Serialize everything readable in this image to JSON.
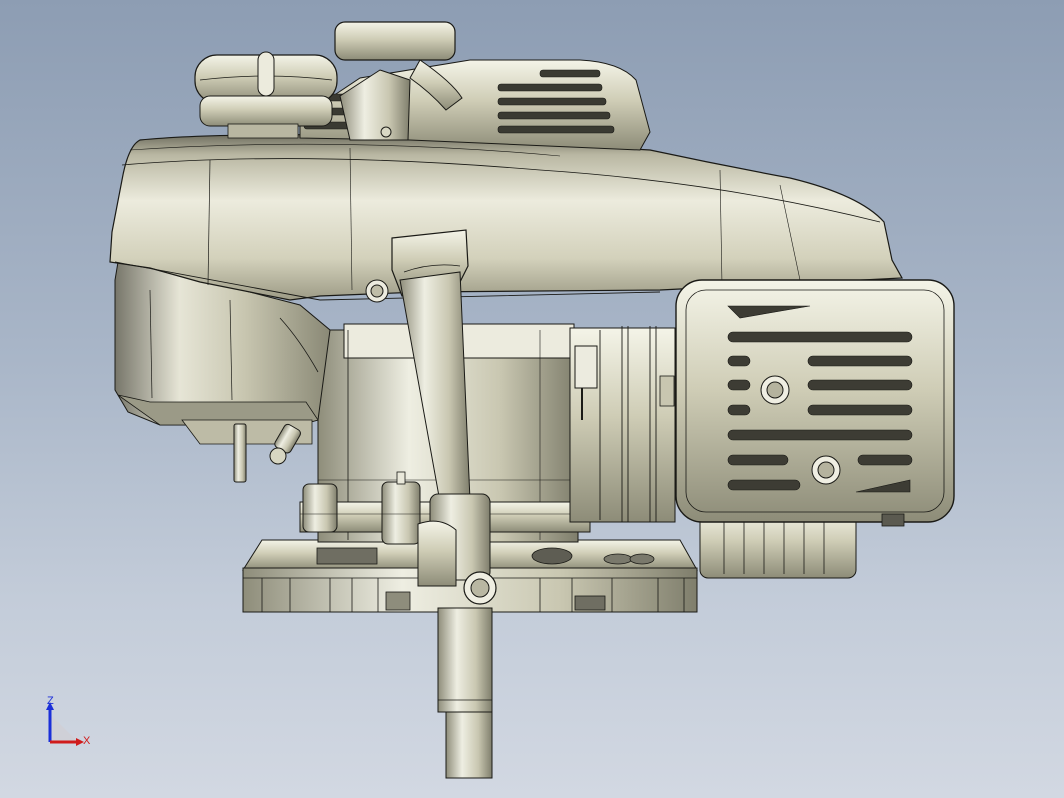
{
  "viewport": {
    "background_top": "#8d9db3",
    "background_bottom": "#d2d8e2"
  },
  "model": {
    "name": "engine-assembly",
    "render_style": "shaded-with-edges",
    "body_color": "#d9d8c4",
    "edge_color": "#1a1a16"
  },
  "triad": {
    "z_label": "Z",
    "x_label": "X",
    "z_color": "#1b2fd9",
    "x_color": "#d01c1c"
  }
}
